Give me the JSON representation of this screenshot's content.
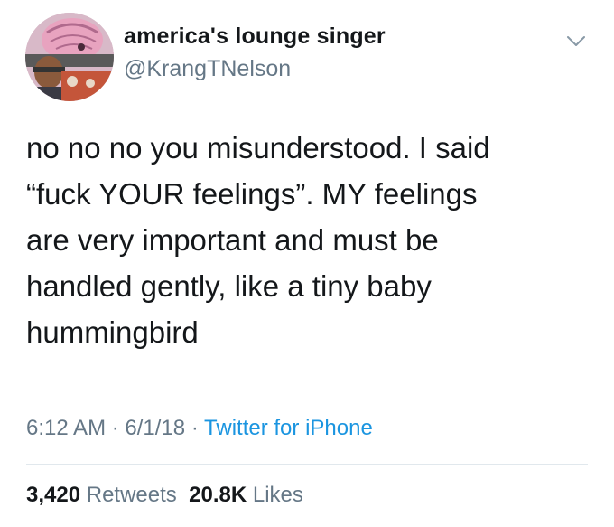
{
  "user": {
    "display_name": "america's lounge singer",
    "handle": "@KrangTNelson",
    "avatar_icon": "krang-avatar"
  },
  "tweet": {
    "lines": [
      "no no no you misunderstood. I said",
      "“fuck YOUR feelings”. MY feelings",
      "are very important and must be",
      "handled gently, like a tiny baby",
      "hummingbird"
    ]
  },
  "meta": {
    "time": "6:12 AM",
    "separator": "·",
    "date": "6/1/18",
    "source": "Twitter for iPhone"
  },
  "stats": {
    "retweets_count": "3,420",
    "retweets_label": "Retweets",
    "likes_count": "20.8K",
    "likes_label": "Likes"
  },
  "colors": {
    "text": "#14171a",
    "secondary": "#657786",
    "link": "#1b95e0",
    "divider": "#e1e8ed"
  }
}
